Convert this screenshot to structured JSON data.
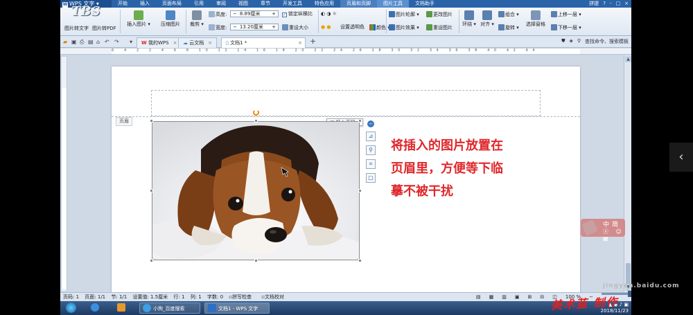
{
  "menubar": {
    "app_button": "WPS 文字",
    "tabs": [
      "开始",
      "插入",
      "页面布局",
      "引用",
      "审阅",
      "视图",
      "章节",
      "开发工具",
      "特色应用",
      "页眉和页脚",
      "图片工具",
      "文档助手"
    ],
    "active_tab": "图片工具",
    "right": [
      "拼提",
      "?",
      "-",
      "□",
      "×"
    ]
  },
  "ribbon": {
    "pic_to_text": "图片转文字",
    "pic_to_pdf": "图片转PDF",
    "insert_picture": "插入图片",
    "compress_picture": "压缩图片",
    "crop": "裁剪",
    "height_label": "高度:",
    "height_value": "8.89厘米",
    "width_label": "宽度:",
    "width_value": "13.20厘米",
    "lock_ratio": "锁定纵横比",
    "reset_size": "重设大小",
    "set_transparent": "设置透明色",
    "color": "颜色",
    "picture_outline": "图片轮廓",
    "picture_effect": "图片效果",
    "change_picture": "更改图片",
    "reset_picture": "重设图片",
    "wrap": "环绕",
    "align": "对齐",
    "rotate": "旋转",
    "group": "组合",
    "selection_pane": "选择窗格",
    "bring_forward": "上移一层",
    "send_backward": "下移一层"
  },
  "tabbar": {
    "tabs": [
      {
        "label": "我的WPS"
      },
      {
        "label": "云文档"
      },
      {
        "label": "文档1 *"
      }
    ],
    "add": "+",
    "search": "查找命令、搜索模板"
  },
  "ruler": {
    "numbers": "6 4 2 2 4 6 8 10 12 14 16 18 20 22 24 26 28 30 32 34 36 38 40 42 44"
  },
  "document": {
    "header_label": "页眉",
    "insert_page_number": "插入页码",
    "annotation": [
      "将插入的图片放置在",
      "页眉里，方便等下临",
      "摹不被干扰"
    ]
  },
  "statusbar": {
    "page_code": "页码: 1",
    "page": "页面: 1/1",
    "section": "节: 1/1",
    "setting": "设置值: 1.5厘米",
    "row": "行: 1",
    "col": "列: 1",
    "words": "字数: 0",
    "spell": "拼写检查",
    "proof": "文档校对",
    "zoom": "100 %"
  },
  "taskbar": {
    "items": [
      {
        "label": "小狗_百度搜索"
      },
      {
        "label": "文档1 - WPS 文字"
      }
    ],
    "date": "2018/11/23"
  },
  "overlays": {
    "logo_big": "TBS",
    "logo_small": "studio",
    "ime_top": "中简",
    "ime_bottom": "ⓐ ☺ ▦",
    "watermark": "jingyan.baidu.com",
    "signature": "美术蓝 制作"
  }
}
